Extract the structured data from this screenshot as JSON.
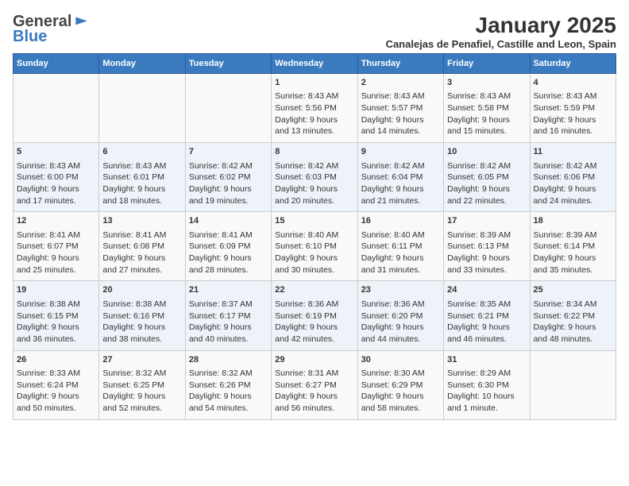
{
  "header": {
    "logo_general": "General",
    "logo_blue": "Blue",
    "month_title": "January 2025",
    "location": "Canalejas de Penafiel, Castille and Leon, Spain"
  },
  "weekdays": [
    "Sunday",
    "Monday",
    "Tuesday",
    "Wednesday",
    "Thursday",
    "Friday",
    "Saturday"
  ],
  "weeks": [
    [
      {
        "day": "",
        "info": ""
      },
      {
        "day": "",
        "info": ""
      },
      {
        "day": "",
        "info": ""
      },
      {
        "day": "1",
        "info": "Sunrise: 8:43 AM\nSunset: 5:56 PM\nDaylight: 9 hours\nand 13 minutes."
      },
      {
        "day": "2",
        "info": "Sunrise: 8:43 AM\nSunset: 5:57 PM\nDaylight: 9 hours\nand 14 minutes."
      },
      {
        "day": "3",
        "info": "Sunrise: 8:43 AM\nSunset: 5:58 PM\nDaylight: 9 hours\nand 15 minutes."
      },
      {
        "day": "4",
        "info": "Sunrise: 8:43 AM\nSunset: 5:59 PM\nDaylight: 9 hours\nand 16 minutes."
      }
    ],
    [
      {
        "day": "5",
        "info": "Sunrise: 8:43 AM\nSunset: 6:00 PM\nDaylight: 9 hours\nand 17 minutes."
      },
      {
        "day": "6",
        "info": "Sunrise: 8:43 AM\nSunset: 6:01 PM\nDaylight: 9 hours\nand 18 minutes."
      },
      {
        "day": "7",
        "info": "Sunrise: 8:42 AM\nSunset: 6:02 PM\nDaylight: 9 hours\nand 19 minutes."
      },
      {
        "day": "8",
        "info": "Sunrise: 8:42 AM\nSunset: 6:03 PM\nDaylight: 9 hours\nand 20 minutes."
      },
      {
        "day": "9",
        "info": "Sunrise: 8:42 AM\nSunset: 6:04 PM\nDaylight: 9 hours\nand 21 minutes."
      },
      {
        "day": "10",
        "info": "Sunrise: 8:42 AM\nSunset: 6:05 PM\nDaylight: 9 hours\nand 22 minutes."
      },
      {
        "day": "11",
        "info": "Sunrise: 8:42 AM\nSunset: 6:06 PM\nDaylight: 9 hours\nand 24 minutes."
      }
    ],
    [
      {
        "day": "12",
        "info": "Sunrise: 8:41 AM\nSunset: 6:07 PM\nDaylight: 9 hours\nand 25 minutes."
      },
      {
        "day": "13",
        "info": "Sunrise: 8:41 AM\nSunset: 6:08 PM\nDaylight: 9 hours\nand 27 minutes."
      },
      {
        "day": "14",
        "info": "Sunrise: 8:41 AM\nSunset: 6:09 PM\nDaylight: 9 hours\nand 28 minutes."
      },
      {
        "day": "15",
        "info": "Sunrise: 8:40 AM\nSunset: 6:10 PM\nDaylight: 9 hours\nand 30 minutes."
      },
      {
        "day": "16",
        "info": "Sunrise: 8:40 AM\nSunset: 6:11 PM\nDaylight: 9 hours\nand 31 minutes."
      },
      {
        "day": "17",
        "info": "Sunrise: 8:39 AM\nSunset: 6:13 PM\nDaylight: 9 hours\nand 33 minutes."
      },
      {
        "day": "18",
        "info": "Sunrise: 8:39 AM\nSunset: 6:14 PM\nDaylight: 9 hours\nand 35 minutes."
      }
    ],
    [
      {
        "day": "19",
        "info": "Sunrise: 8:38 AM\nSunset: 6:15 PM\nDaylight: 9 hours\nand 36 minutes."
      },
      {
        "day": "20",
        "info": "Sunrise: 8:38 AM\nSunset: 6:16 PM\nDaylight: 9 hours\nand 38 minutes."
      },
      {
        "day": "21",
        "info": "Sunrise: 8:37 AM\nSunset: 6:17 PM\nDaylight: 9 hours\nand 40 minutes."
      },
      {
        "day": "22",
        "info": "Sunrise: 8:36 AM\nSunset: 6:19 PM\nDaylight: 9 hours\nand 42 minutes."
      },
      {
        "day": "23",
        "info": "Sunrise: 8:36 AM\nSunset: 6:20 PM\nDaylight: 9 hours\nand 44 minutes."
      },
      {
        "day": "24",
        "info": "Sunrise: 8:35 AM\nSunset: 6:21 PM\nDaylight: 9 hours\nand 46 minutes."
      },
      {
        "day": "25",
        "info": "Sunrise: 8:34 AM\nSunset: 6:22 PM\nDaylight: 9 hours\nand 48 minutes."
      }
    ],
    [
      {
        "day": "26",
        "info": "Sunrise: 8:33 AM\nSunset: 6:24 PM\nDaylight: 9 hours\nand 50 minutes."
      },
      {
        "day": "27",
        "info": "Sunrise: 8:32 AM\nSunset: 6:25 PM\nDaylight: 9 hours\nand 52 minutes."
      },
      {
        "day": "28",
        "info": "Sunrise: 8:32 AM\nSunset: 6:26 PM\nDaylight: 9 hours\nand 54 minutes."
      },
      {
        "day": "29",
        "info": "Sunrise: 8:31 AM\nSunset: 6:27 PM\nDaylight: 9 hours\nand 56 minutes."
      },
      {
        "day": "30",
        "info": "Sunrise: 8:30 AM\nSunset: 6:29 PM\nDaylight: 9 hours\nand 58 minutes."
      },
      {
        "day": "31",
        "info": "Sunrise: 8:29 AM\nSunset: 6:30 PM\nDaylight: 10 hours\nand 1 minute."
      },
      {
        "day": "",
        "info": ""
      }
    ]
  ]
}
